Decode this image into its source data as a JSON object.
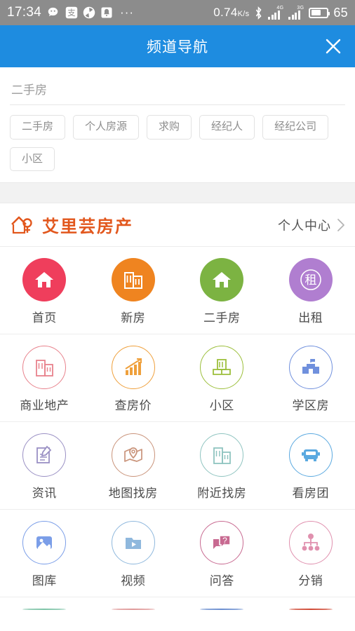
{
  "statusbar": {
    "time": "17:34",
    "app_icons": [
      "wechat-icon",
      "alipay-icon",
      "circle-app-icon",
      "notification-bell-icon"
    ],
    "overflow": "···",
    "network_speed": "0.74",
    "network_speed_unit": "K/s",
    "bluetooth": "bluetooth-icon",
    "signal_1_label": "4G",
    "signal_2_label": "3G",
    "battery_percent": "65"
  },
  "header": {
    "title": "频道导航",
    "close_label": "close-icon",
    "bg_color": "#1e8ce0"
  },
  "search": {
    "value": "二手房",
    "placeholder": "二手房",
    "tags": [
      "二手房",
      "个人房源",
      "求购",
      "经纪人",
      "经纪公司",
      "小区"
    ]
  },
  "brand": {
    "logo": "house-logo-icon",
    "name": "艾里芸房产",
    "brand_color": "#e2571d",
    "user_center_label": "个人中心",
    "chevron": "chevron-right-icon"
  },
  "grid": {
    "rows": [
      {
        "cells": [
          {
            "label": "首页",
            "icon": "home-icon",
            "style": "filled",
            "color": "#ef3e5c"
          },
          {
            "label": "新房",
            "icon": "building-icon",
            "style": "filled",
            "color": "#ef8420"
          },
          {
            "label": "二手房",
            "icon": "home-icon",
            "style": "filled",
            "color": "#7cb342"
          },
          {
            "label": "出租",
            "icon": "rent-char-icon",
            "style": "filled",
            "color": "#b07ed0"
          }
        ]
      },
      {
        "cells": [
          {
            "label": "商业地产",
            "icon": "commercial-building-icon",
            "style": "outline",
            "color": "#e8828c"
          },
          {
            "label": "查房价",
            "icon": "chart-up-icon",
            "style": "outline",
            "color": "#efa03c"
          },
          {
            "label": "小区",
            "icon": "community-book-icon",
            "style": "outline",
            "color": "#9cbf3b"
          },
          {
            "label": "学区房",
            "icon": "school-icon",
            "style": "outline",
            "color": "#7090dd"
          }
        ]
      },
      {
        "cells": [
          {
            "label": "资讯",
            "icon": "document-pen-icon",
            "style": "outline",
            "color": "#9a90c4"
          },
          {
            "label": "地图找房",
            "icon": "map-pin-icon",
            "style": "outline",
            "color": "#c9937a"
          },
          {
            "label": "附近找房",
            "icon": "nearby-buildings-icon",
            "style": "outline",
            "color": "#8fc4c0"
          },
          {
            "label": "看房团",
            "icon": "bus-icon",
            "style": "outline",
            "color": "#5aa9e0"
          }
        ]
      },
      {
        "cells": [
          {
            "label": "图库",
            "icon": "image-gallery-icon",
            "style": "outline",
            "color": "#7b9ee8"
          },
          {
            "label": "视频",
            "icon": "video-folder-icon",
            "style": "outline",
            "color": "#8fb8dd"
          },
          {
            "label": "问答",
            "icon": "question-chat-icon",
            "style": "outline",
            "color": "#c86a91"
          },
          {
            "label": "分销",
            "icon": "distribution-icon",
            "style": "outline",
            "color": "#e090ae"
          }
        ]
      },
      {
        "clipped": true,
        "cells": [
          {
            "label": "",
            "icon": "partial-icon-1",
            "style": "outline",
            "color": "#7fc4a8"
          },
          {
            "label": "",
            "icon": "partial-icon-2",
            "style": "outline",
            "color": "#e09a9a"
          },
          {
            "label": "",
            "icon": "partial-icon-3",
            "style": "outline",
            "color": "#6c8fd0"
          },
          {
            "label": "",
            "icon": "partial-icon-4",
            "style": "outline",
            "color": "#d04a36"
          }
        ]
      }
    ]
  }
}
